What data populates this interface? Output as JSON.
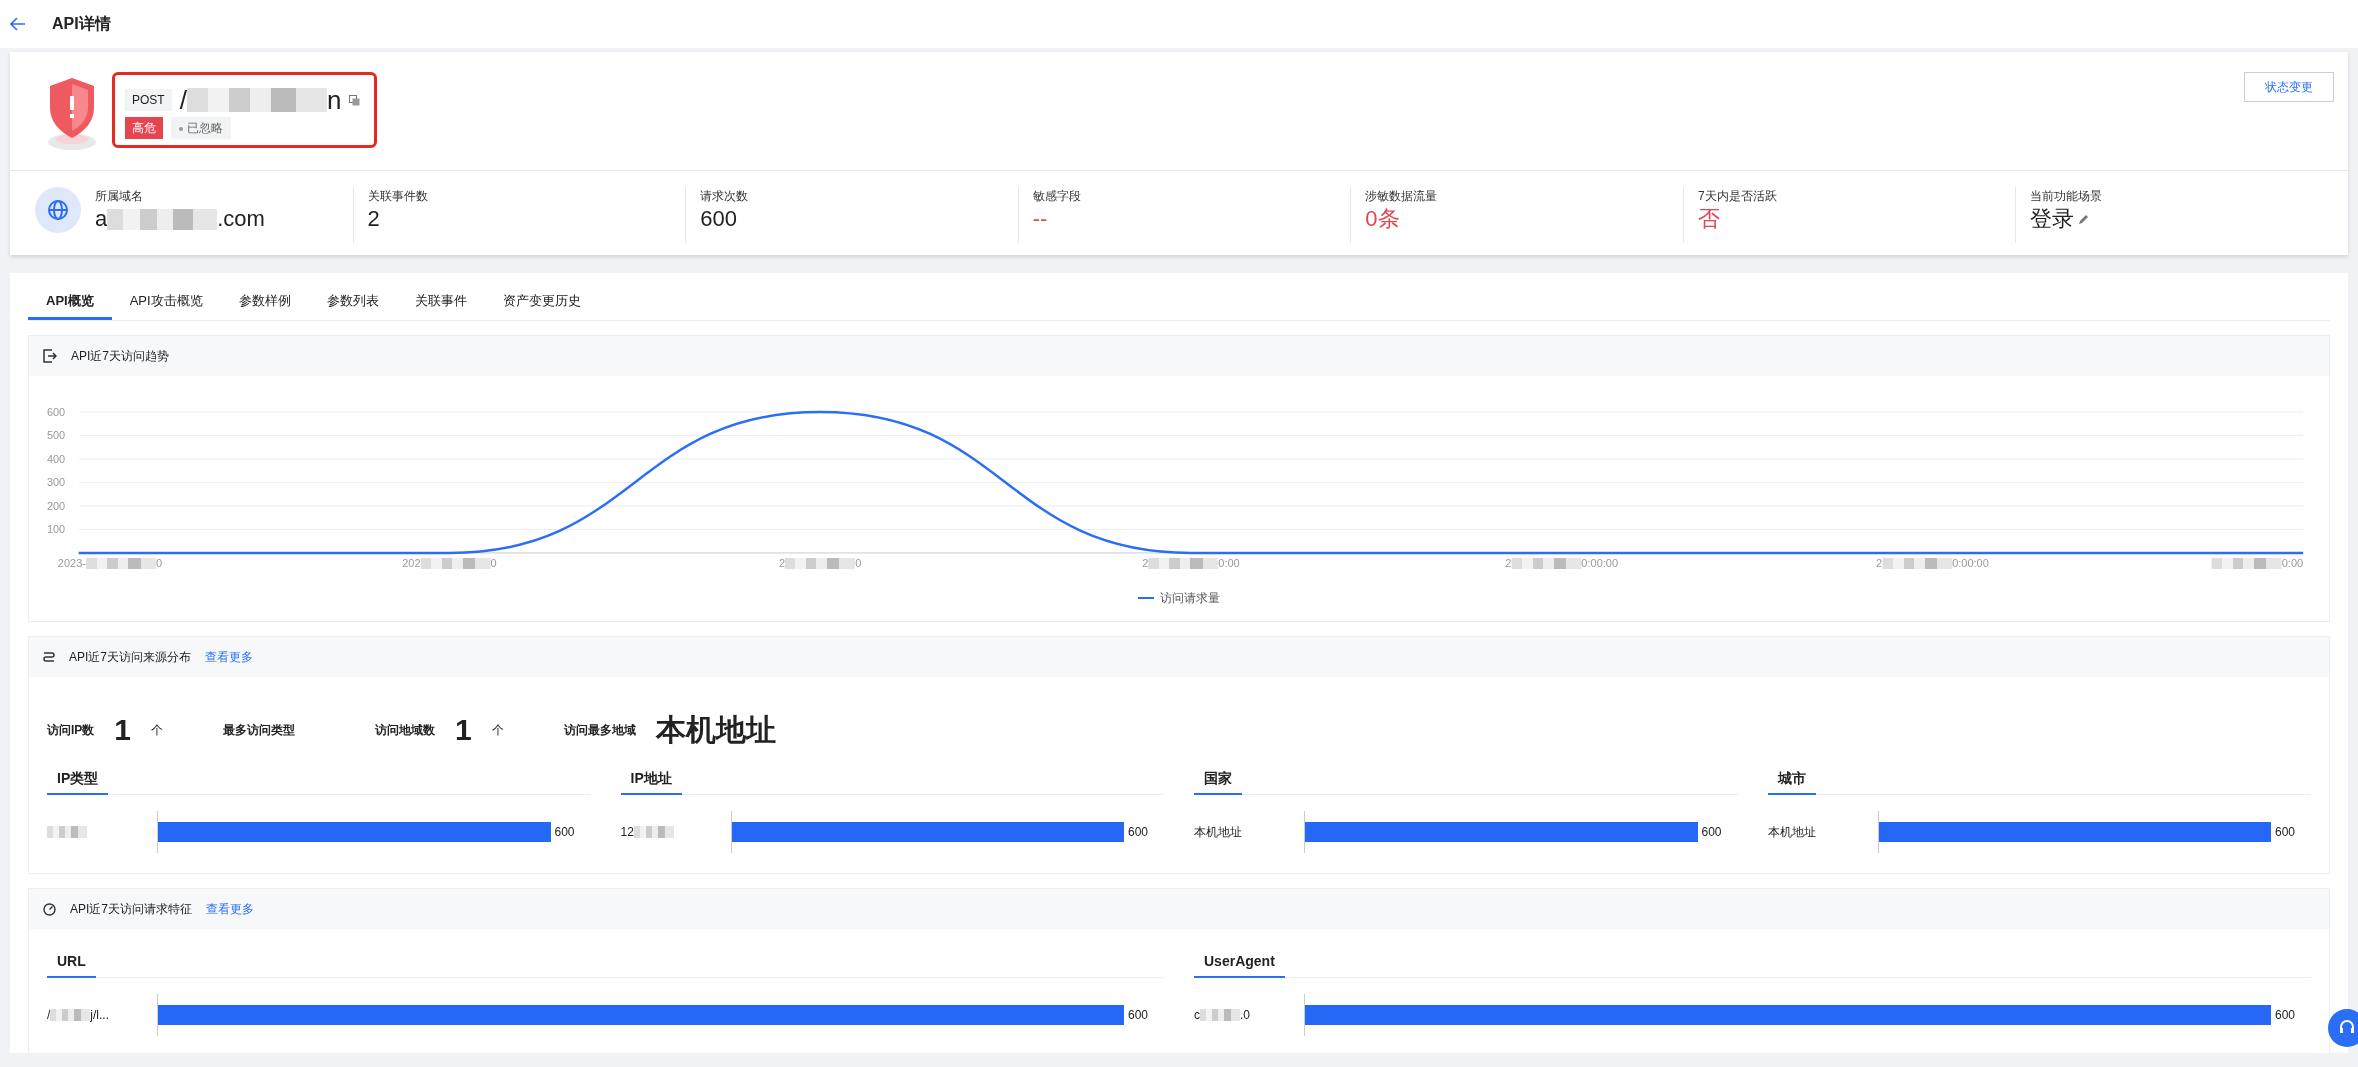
{
  "header": {
    "title": "API详情"
  },
  "api": {
    "method": "POST",
    "path": [
      {
        "kind": "text",
        "text": "/"
      },
      {
        "kind": "redaction"
      },
      {
        "kind": "text",
        "text": "n"
      }
    ],
    "risk_tag": "高危",
    "status": "已忽略",
    "action_button": "状态变更"
  },
  "stats": [
    {
      "kind": "domain",
      "label": "所属域名",
      "value": [
        {
          "kind": "text",
          "text": "a"
        },
        {
          "kind": "redaction"
        },
        {
          "kind": "text",
          "text": ".com"
        }
      ]
    },
    {
      "kind": "plain",
      "label": "关联事件数",
      "value": "2"
    },
    {
      "kind": "plain",
      "label": "请求次数",
      "value": "600"
    },
    {
      "kind": "alert",
      "label": "敏感字段",
      "value": "--"
    },
    {
      "kind": "alert",
      "label": "涉敏数据流量",
      "value": "0条"
    },
    {
      "kind": "alert",
      "label": "7天内是否活跃",
      "value": "否"
    },
    {
      "kind": "editable",
      "label": "当前功能场景",
      "value": "登录"
    }
  ],
  "tabs": [
    {
      "label": "API概览",
      "selected": true
    },
    {
      "label": "API攻击概览",
      "selected": false
    },
    {
      "label": "参数样例",
      "selected": false
    },
    {
      "label": "参数列表",
      "selected": false
    },
    {
      "label": "关联事件",
      "selected": false
    },
    {
      "label": "资产变更历史",
      "selected": false
    }
  ],
  "trend_panel": {
    "title": "API近7天访问趋势",
    "chart_data": {
      "type": "line",
      "grid": true,
      "ylim": [
        0,
        600
      ],
      "yticks": [
        100,
        200,
        300,
        400,
        500,
        600
      ],
      "series": [
        {
          "name": "访问请求量",
          "color": "#2b6ef6",
          "values": [
            0,
            0,
            600,
            0,
            0,
            0,
            0
          ]
        }
      ]
    },
    "x_labels": [
      [
        {
          "kind": "text",
          "text": "2023-"
        },
        {
          "kind": "redaction"
        },
        {
          "kind": "text",
          "text": "0"
        }
      ],
      [
        {
          "kind": "text",
          "text": "202"
        },
        {
          "kind": "redaction"
        },
        {
          "kind": "text",
          "text": "0"
        }
      ],
      [
        {
          "kind": "text",
          "text": "2"
        },
        {
          "kind": "redaction"
        },
        {
          "kind": "text",
          "text": "0"
        }
      ],
      [
        {
          "kind": "text",
          "text": "2"
        },
        {
          "kind": "redaction"
        },
        {
          "kind": "text",
          "text": "0:00"
        }
      ],
      [
        {
          "kind": "text",
          "text": "2"
        },
        {
          "kind": "redaction"
        },
        {
          "kind": "text",
          "text": "0:00:00"
        }
      ],
      [
        {
          "kind": "text",
          "text": "2"
        },
        {
          "kind": "redaction"
        },
        {
          "kind": "text",
          "text": "0:00:00"
        }
      ],
      [
        {
          "kind": "redaction"
        },
        {
          "kind": "text",
          "text": "0:00"
        }
      ]
    ]
  },
  "source_panel": {
    "title": "API近7天访问来源分布",
    "link": "查看更多",
    "metrics": [
      {
        "label": "访问IP数",
        "value": "1",
        "unit": "个"
      },
      {
        "label": "最多访问类型"
      },
      {
        "label": "访问地域数",
        "value": "1",
        "unit": "个"
      },
      {
        "label": "访问最多地域",
        "value": "本机地址"
      }
    ],
    "groups": [
      {
        "title": "IP类型",
        "rows": [
          {
            "label": [
              {
                "kind": "redaction"
              }
            ],
            "value": "600",
            "level": 1
          }
        ]
      },
      {
        "title": "IP地址",
        "rows": [
          {
            "label": [
              {
                "kind": "text",
                "text": "12"
              },
              {
                "kind": "redaction"
              }
            ],
            "value": "600",
            "level": 1
          }
        ]
      },
      {
        "title": "国家",
        "rows": [
          {
            "label": [
              {
                "kind": "text",
                "text": "本机地址"
              }
            ],
            "value": "600",
            "level": 1
          }
        ]
      },
      {
        "title": "城市",
        "rows": [
          {
            "label": [
              {
                "kind": "text",
                "text": "本机地址"
              }
            ],
            "value": "600",
            "level": 1
          }
        ]
      }
    ]
  },
  "feature_panel": {
    "title": "API近7天访问请求特征",
    "link": "查看更多",
    "groups": [
      {
        "title": "URL",
        "rows": [
          {
            "label": [
              {
                "kind": "text",
                "text": "/"
              },
              {
                "kind": "redaction"
              },
              {
                "kind": "text",
                "text": "j/l..."
              }
            ],
            "value": "600",
            "level": 1
          }
        ]
      },
      {
        "title": "UserAgent",
        "rows": [
          {
            "label": [
              {
                "kind": "text",
                "text": "c"
              },
              {
                "kind": "redaction"
              },
              {
                "kind": "text",
                "text": ".0"
              }
            ],
            "value": "600",
            "level": 1
          }
        ]
      }
    ]
  }
}
